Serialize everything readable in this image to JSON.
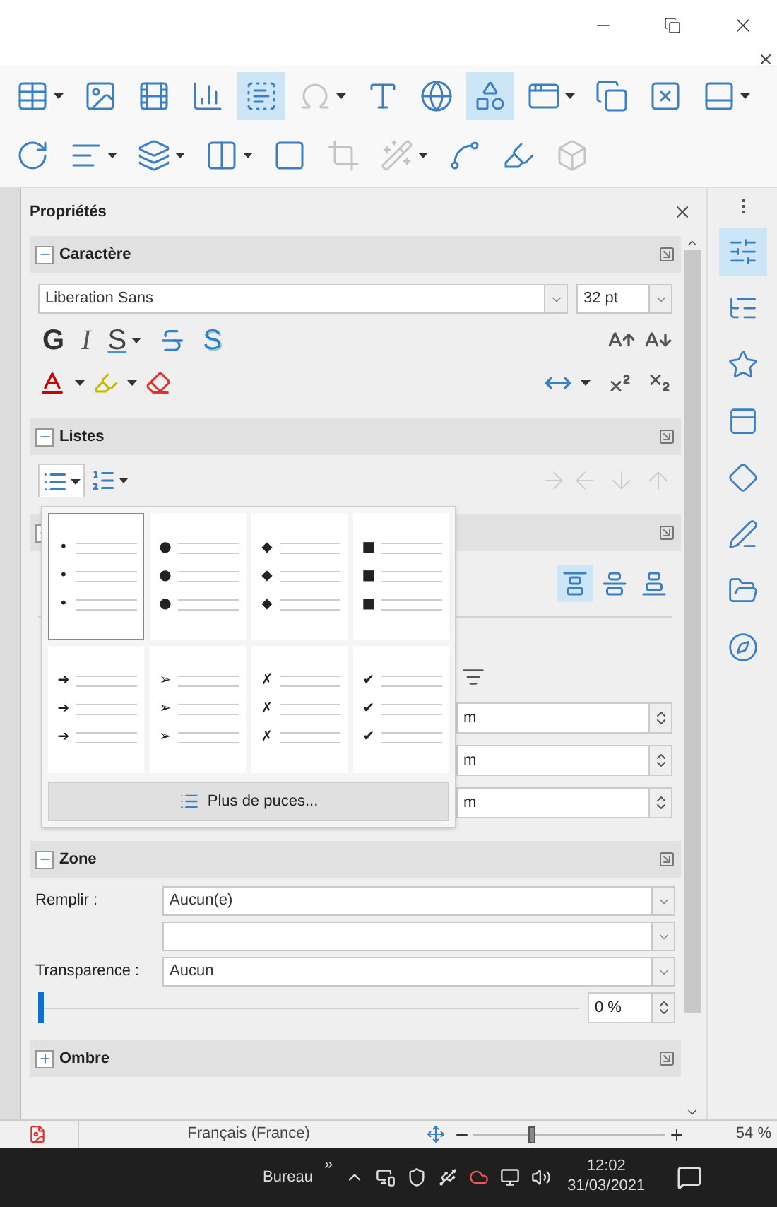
{
  "toolbar_rows": [
    [
      {
        "selected": false,
        "disabled": false,
        "dropdown": true
      },
      {
        "selected": false,
        "disabled": false,
        "dropdown": false
      },
      {
        "selected": false,
        "disabled": false,
        "dropdown": false
      },
      {
        "selected": false,
        "disabled": false,
        "dropdown": false
      },
      {
        "selected": true,
        "disabled": false,
        "dropdown": false
      },
      {
        "selected": false,
        "disabled": true,
        "dropdown": true
      },
      {
        "selected": false,
        "disabled": false,
        "dropdown": false
      },
      {
        "selected": false,
        "disabled": false,
        "dropdown": false
      },
      {
        "selected": true,
        "disabled": false,
        "dropdown": false
      },
      {
        "selected": false,
        "disabled": false,
        "dropdown": true
      },
      {
        "selected": false,
        "disabled": false,
        "dropdown": false
      },
      {
        "selected": false,
        "disabled": false,
        "dropdown": false
      },
      {
        "selected": false,
        "disabled": false,
        "dropdown": true
      }
    ],
    [
      {
        "selected": false,
        "disabled": false,
        "dropdown": false
      },
      {
        "selected": false,
        "disabled": false,
        "dropdown": true
      },
      {
        "selected": false,
        "disabled": false,
        "dropdown": true
      },
      {
        "selected": false,
        "disabled": false,
        "dropdown": true
      },
      {
        "selected": false,
        "disabled": false,
        "dropdown": false
      },
      {
        "selected": false,
        "disabled": true,
        "dropdown": false
      },
      {
        "selected": false,
        "disabled": true,
        "dropdown": true
      },
      {
        "selected": false,
        "disabled": false,
        "dropdown": false
      },
      {
        "selected": false,
        "disabled": false,
        "dropdown": false
      },
      {
        "selected": false,
        "disabled": true,
        "dropdown": false
      }
    ]
  ],
  "sidebar": {
    "title": "Propriétés",
    "sections": [
      {
        "kind": "character",
        "title": "Caractère",
        "expanded": true,
        "font": "Liberation Sans",
        "size": "32 pt",
        "format_buttons": [
          {
            "kind": "bold",
            "label": "G",
            "dropdown": false
          },
          {
            "kind": "italic",
            "label": "I",
            "dropdown": false
          },
          {
            "kind": "underline",
            "label": "S",
            "dropdown": true
          },
          {
            "kind": "strike",
            "dropdown": false
          },
          {
            "kind": "shadow",
            "label": "S",
            "dropdown": false
          }
        ]
      },
      {
        "kind": "lists",
        "title": "Listes",
        "expanded": true,
        "bullets_open": true
      },
      {
        "kind": "paragraph",
        "expanded": true,
        "alignment": [
          {
            "selected": true
          },
          {
            "selected": false
          },
          {
            "selected": false
          }
        ],
        "spin_values": [
          "m",
          "m",
          "m"
        ]
      },
      {
        "kind": "area",
        "title": "Zone",
        "expanded": true,
        "fill_label": "Remplir :",
        "fill": "Aucun(e)",
        "transparency_label": "Transparence :",
        "transparency": "Aucun",
        "slider": {
          "level": 0
        },
        "percent": "0 %"
      },
      {
        "kind": "shadow",
        "title": "Ombre",
        "expanded": false
      }
    ]
  },
  "bullet_popup": {
    "bullets": [
      {
        "glyphs": [
          "•",
          "•",
          "•"
        ],
        "selected": true
      },
      {
        "glyphs": [
          "●",
          "●",
          "●"
        ],
        "selected": false
      },
      {
        "glyphs": [
          "◆",
          "◆",
          "◆"
        ],
        "selected": false
      },
      {
        "glyphs": [
          "■",
          "■",
          "■"
        ],
        "selected": false
      },
      {
        "glyphs": [
          "➔",
          "➔",
          "➔"
        ],
        "selected": false
      },
      {
        "glyphs": [
          "➢",
          "➢",
          "➢"
        ],
        "selected": false
      },
      {
        "glyphs": [
          "✗",
          "✗",
          "✗"
        ],
        "selected": false
      },
      {
        "glyphs": [
          "✔",
          "✔",
          "✔"
        ],
        "selected": false
      }
    ],
    "more_button": "Plus de puces..."
  },
  "deck_tabs": [
    {
      "selected": true
    },
    {
      "selected": false
    },
    {
      "selected": false
    },
    {
      "selected": false
    },
    {
      "selected": false
    },
    {
      "selected": false
    },
    {
      "selected": false
    },
    {
      "selected": false
    }
  ],
  "status_bar": {
    "language": "Français (France)",
    "zoom": {
      "level": 0.3
    },
    "zoom_percent": "54 %"
  },
  "taskbar": {
    "toolbar": "Bureau",
    "chevron": "»",
    "time": "12:02",
    "date": "31/03/2021"
  }
}
